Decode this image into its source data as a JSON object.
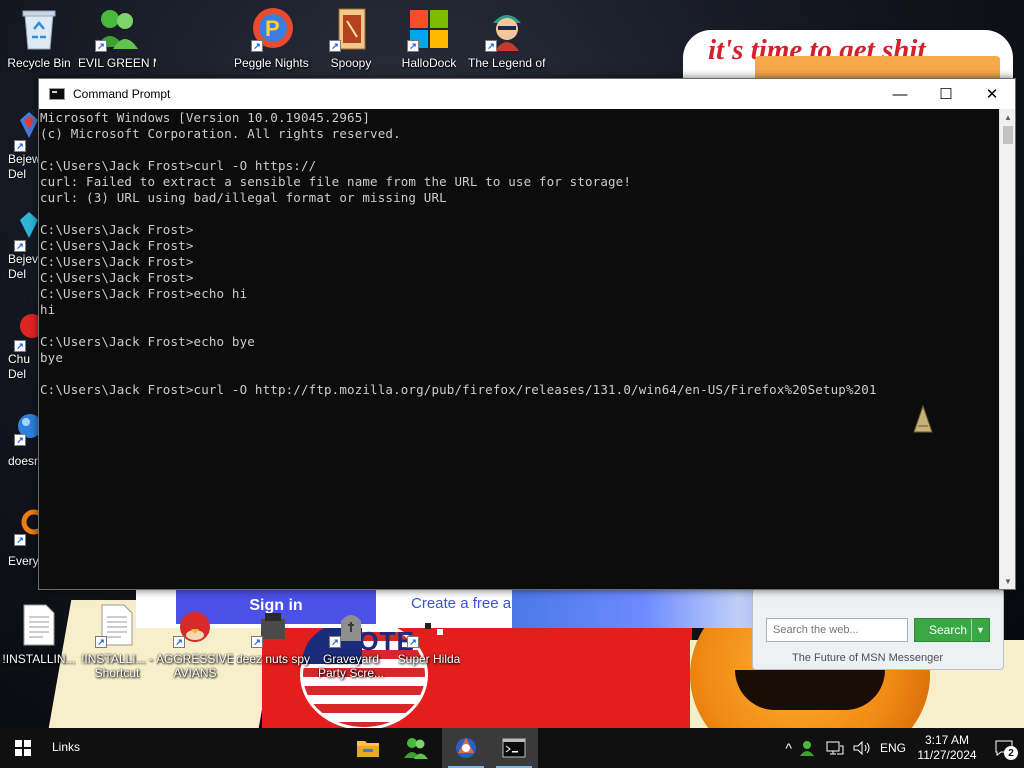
{
  "desktop": {
    "top_icons": [
      {
        "label": "Recycle Bin",
        "icon": "recycle-bin-icon"
      },
      {
        "label": "EVIL GREEN MSN SO...",
        "icon": "msn-buddy-icon"
      },
      {
        "label": "Peggle Nights Del...",
        "icon": "peggle-icon"
      },
      {
        "label": "Spoopy",
        "icon": "document-icon"
      },
      {
        "label": "HalloDock",
        "icon": "windows-logo-icon"
      },
      {
        "label": "The Legend of Ti...",
        "icon": "game-character-icon"
      }
    ],
    "left_icons": [
      {
        "label_line1": "Bejew",
        "label_line2": "Del",
        "icon": "bejeweled-icon"
      },
      {
        "label_line1": "Bejev",
        "label_line2": "Del",
        "icon": "diamond-icon"
      },
      {
        "label_line1": "Chu",
        "label_line2": "Del",
        "icon": "red-ball-icon"
      },
      {
        "label_line1": "doesn",
        "label_line2": "",
        "icon": "blue-orb-icon"
      },
      {
        "label_line1": "Every",
        "label_line2": "",
        "icon": "orange-icon"
      }
    ],
    "bottom_icons": [
      {
        "label": "!INSTALLIN...",
        "icon": "text-file-icon"
      },
      {
        "label": "!INSTALLI... - Shortcut",
        "icon": "text-file-shortcut-icon"
      },
      {
        "label": "AGGRESSIVE AVIANS",
        "icon": "angry-bird-icon"
      },
      {
        "label": "deez nuts spy",
        "icon": "spy-icon"
      },
      {
        "label": "Graveyard Party Scre...",
        "icon": "graveyard-icon"
      },
      {
        "label": "Super Hilda",
        "icon": "pixel-game-icon"
      }
    ],
    "wallpaper_text": "it's time to get shit",
    "vote_text": "VOTE"
  },
  "background_browser": {
    "sign_in_label": "Sign in",
    "create_link": "Create a free a",
    "msn_search_placeholder": "Search the web...",
    "msn_search_button": "Search",
    "msn_footer": "The Future of MSN Messenger"
  },
  "cmd": {
    "title": "Command Prompt",
    "lines": [
      "Microsoft Windows [Version 10.0.19045.2965]",
      "(c) Microsoft Corporation. All rights reserved.",
      "",
      "C:\\Users\\Jack Frost>curl -O https://",
      "curl: Failed to extract a sensible file name from the URL to use for storage!",
      "curl: (3) URL using bad/illegal format or missing URL",
      "",
      "C:\\Users\\Jack Frost>",
      "C:\\Users\\Jack Frost>",
      "C:\\Users\\Jack Frost>",
      "C:\\Users\\Jack Frost>",
      "C:\\Users\\Jack Frost>echo hi",
      "hi",
      "",
      "C:\\Users\\Jack Frost>echo bye",
      "bye",
      "",
      "C:\\Users\\Jack Frost>curl -O http://ftp.mozilla.org/pub/firefox/releases/131.0/win64/en-US/Firefox%20Setup%201"
    ],
    "minimize_glyph": "—",
    "maximize_glyph": "☐",
    "close_glyph": "✕"
  },
  "taskbar": {
    "links_label": "Links",
    "apps": [
      {
        "icon": "file-explorer-icon",
        "active": false
      },
      {
        "icon": "msn-messenger-icon",
        "active": false
      },
      {
        "icon": "browser-icon",
        "active": true
      },
      {
        "icon": "command-prompt-icon",
        "active": true
      }
    ],
    "tray": {
      "chevron": "^",
      "language": "ENG",
      "time": "3:17 AM",
      "date": "11/27/2024",
      "notification_count": "2"
    }
  },
  "colors": {
    "cmd_background": "#0c0c0c",
    "cmd_text": "#cccccc",
    "taskbar": "#101010",
    "sign_in_button": "#4b50e6",
    "msn_search_button": "#39a844"
  }
}
